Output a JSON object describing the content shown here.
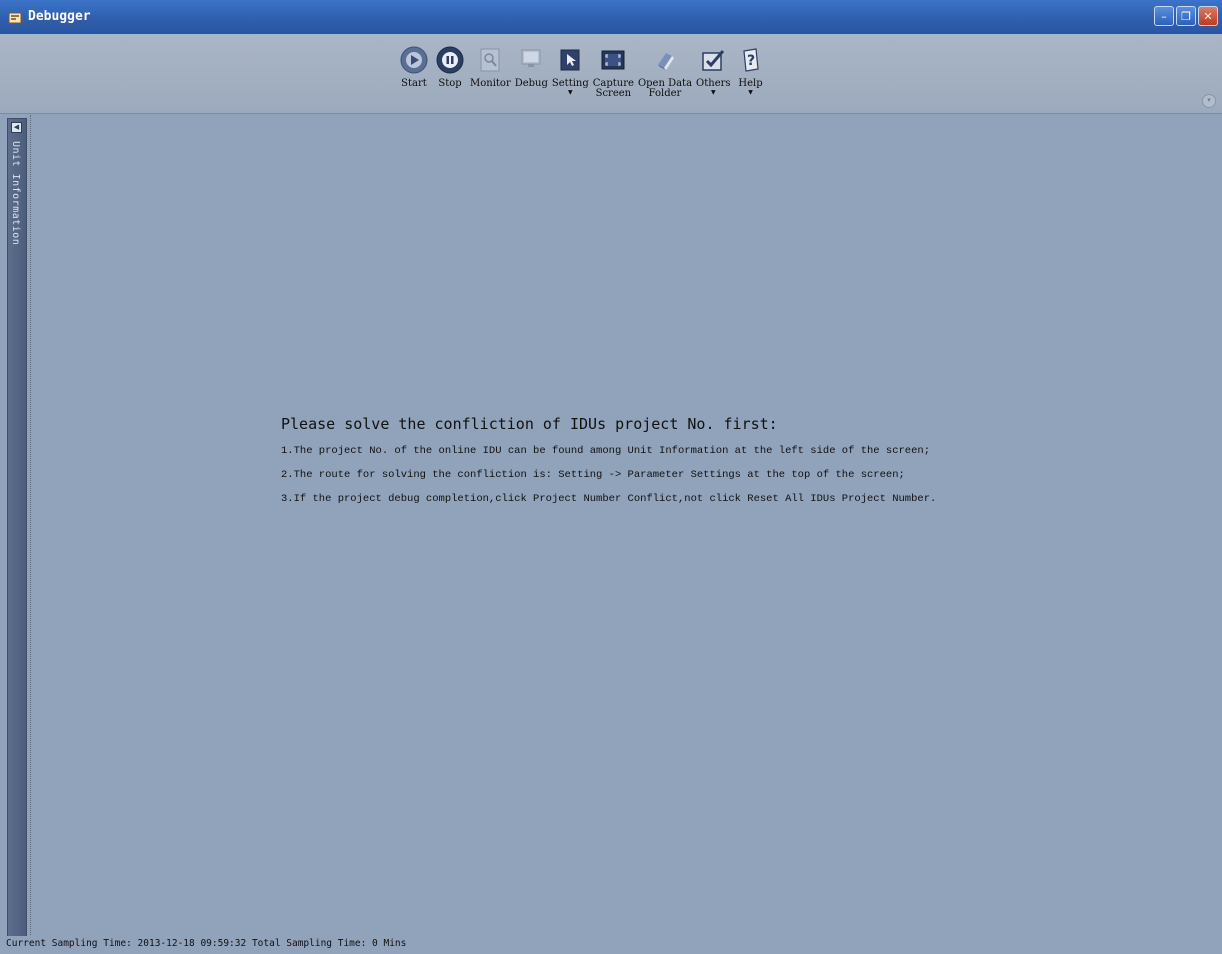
{
  "window": {
    "title": "Debugger"
  },
  "toolbar": {
    "items": [
      {
        "label": "Start",
        "icon": "start-icon"
      },
      {
        "label": "Stop",
        "icon": "stop-icon"
      },
      {
        "label": "Monitor",
        "icon": "monitor-icon"
      },
      {
        "label": "Debug",
        "icon": "debug-icon"
      },
      {
        "label": "Setting",
        "icon": "setting-icon",
        "dropdown": "▼"
      },
      {
        "label": "Capture\nScreen",
        "icon": "capture-screen-icon"
      },
      {
        "label": "Open Data\nFolder",
        "icon": "folder-icon"
      },
      {
        "label": "Others",
        "icon": "others-icon",
        "dropdown": "▼"
      },
      {
        "label": "Help",
        "icon": "help-icon",
        "dropdown": "▼"
      }
    ]
  },
  "sidebar": {
    "tab_label": "Unit Information"
  },
  "message": {
    "title": "Please solve the confliction of IDUs project No. first:",
    "lines": [
      "1.The project No. of the online IDU can be found among Unit Information at the left side of the screen;",
      "2.The route for solving the confliction is: Setting -> Parameter Settings at the top of the screen;",
      "3.If the project debug completion,click Project Number Conflict,not click Reset All IDUs Project Number."
    ]
  },
  "status": {
    "text": "Current Sampling Time: 2013-12-18 09:59:32  Total Sampling Time: 0 Mins"
  },
  "colors": {
    "titlebar": "#2f5fae",
    "background": "#91a2bb",
    "toolbar": "#a3b0c2",
    "close_button": "#c2381c"
  }
}
